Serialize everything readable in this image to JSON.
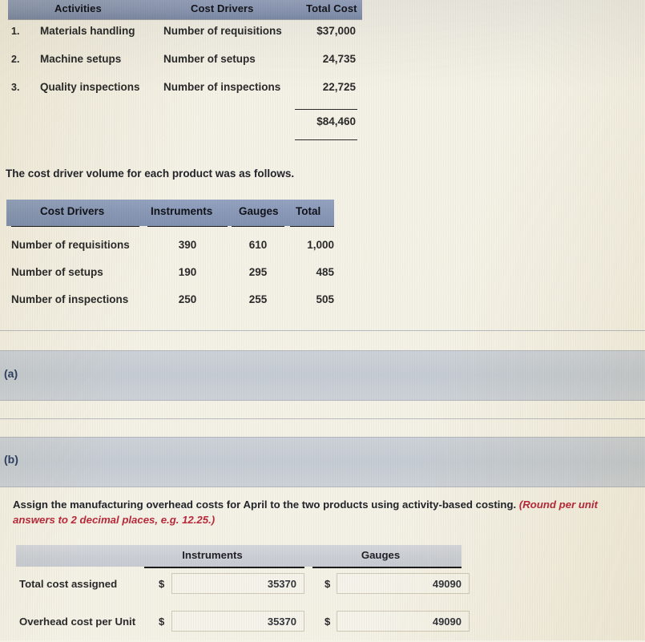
{
  "table_activities": {
    "headers": [
      "Activities",
      "Cost Drivers",
      "Total Cost"
    ],
    "rows": [
      {
        "num": "1.",
        "activity": "Materials handling",
        "driver": "Number of requisitions",
        "cost": "$37,000"
      },
      {
        "num": "2.",
        "activity": "Machine setups",
        "driver": "Number of setups",
        "cost": "24,735"
      },
      {
        "num": "3.",
        "activity": "Quality inspections",
        "driver": "Number of inspections",
        "cost": "22,725"
      }
    ],
    "total": "$84,460"
  },
  "lead_text": "The cost driver volume for each product was as follows.",
  "table_volume": {
    "headers": [
      "Cost Drivers",
      "Instruments",
      "Gauges",
      "Total"
    ],
    "rows": [
      {
        "driver": "Number of requisitions",
        "instruments": "390",
        "gauges": "610",
        "total": "1,000"
      },
      {
        "driver": "Number of setups",
        "instruments": "190",
        "gauges": "295",
        "total": "485"
      },
      {
        "driver": "Number of inspections",
        "instruments": "250",
        "gauges": "255",
        "total": "505"
      }
    ]
  },
  "parts": {
    "a_label": "(a)",
    "b_label": "(b)"
  },
  "question": {
    "main": "Assign the manufacturing overhead costs for April to the two products using activity-based costing.",
    "hint": "(Round per unit answers to 2 decimal places, e.g. 12.25.)"
  },
  "table_answers": {
    "headers": [
      "Instruments",
      "Gauges"
    ],
    "currency_symbol": "$",
    "rows": [
      {
        "label": "Total cost assigned",
        "instruments": "35370",
        "gauges": "49090"
      },
      {
        "label": "Overhead cost per Unit",
        "instruments": "35370",
        "gauges": "49090"
      }
    ]
  },
  "colors": {
    "header_blue": "#8e9bb6",
    "band_gray": "#c6ccd3",
    "hint_red": "#b8293a",
    "part_label_blue": "#2e3f63",
    "paper": "#f4f1e6"
  }
}
